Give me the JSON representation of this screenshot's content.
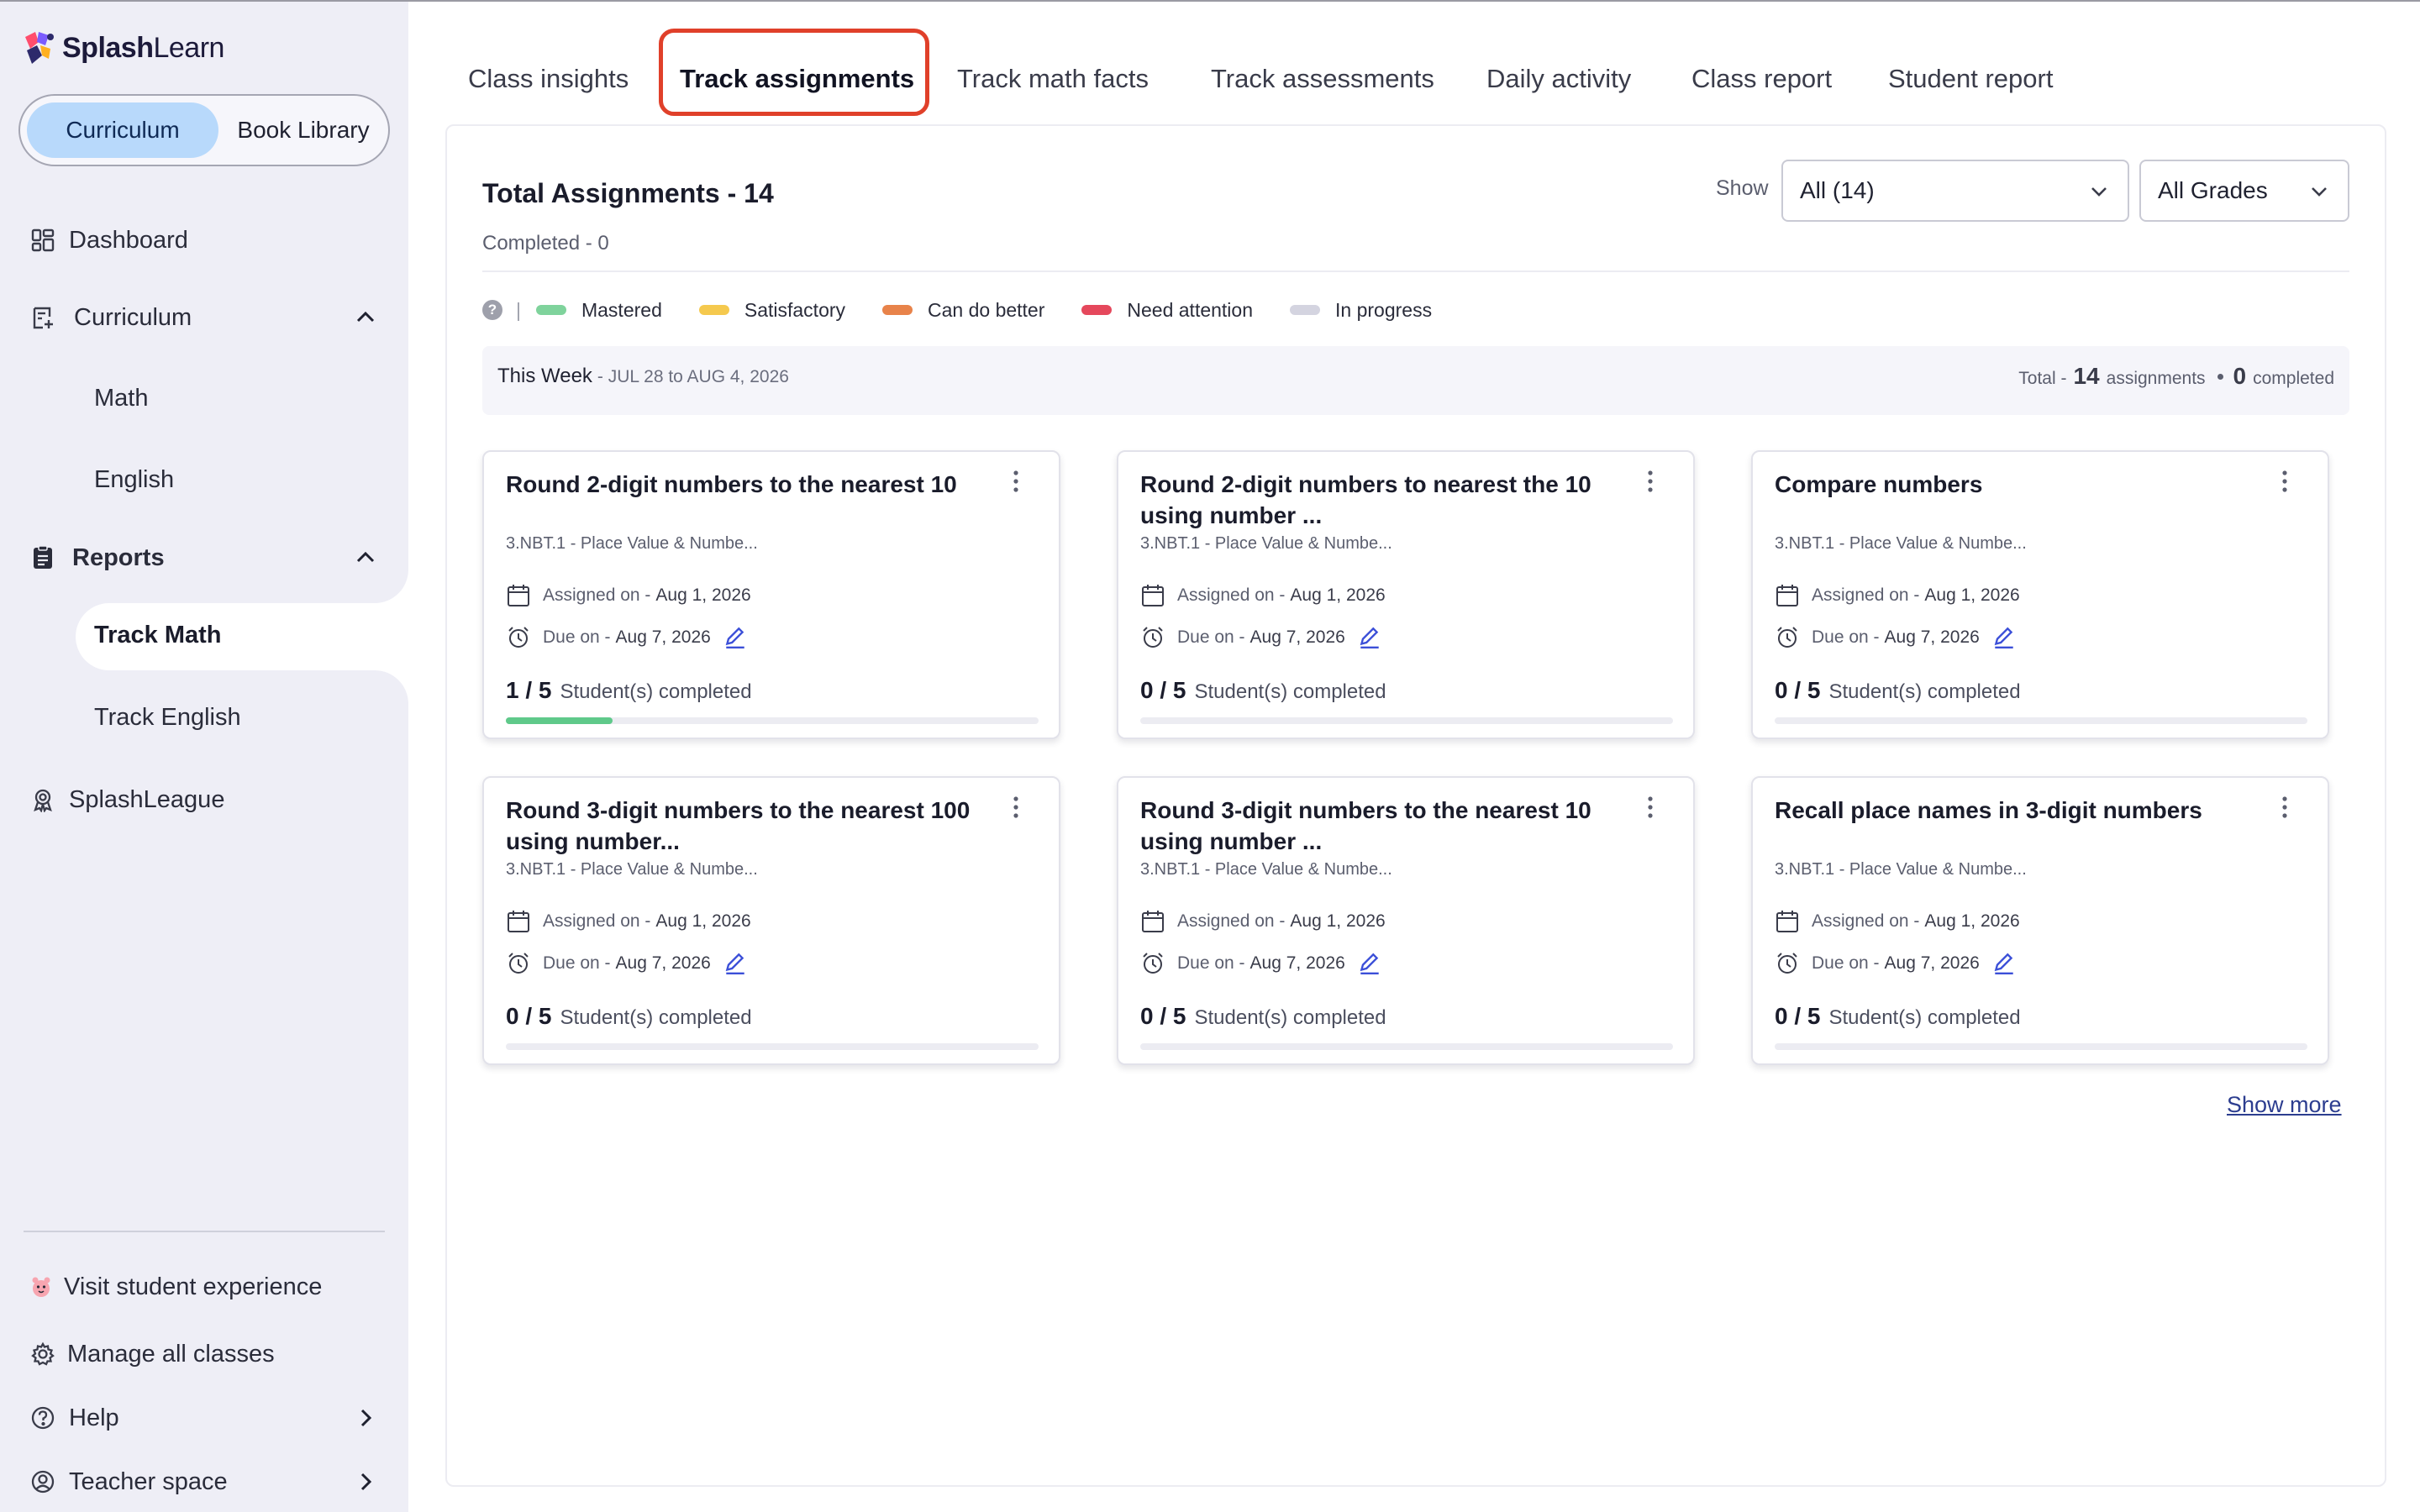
{
  "app": {
    "logo_bold": "Splash",
    "logo_light": "Learn"
  },
  "sidebar": {
    "toggle": {
      "active": "Curriculum",
      "inactive": "Book Library"
    },
    "nav": {
      "dashboard": "Dashboard",
      "curriculum": "Curriculum",
      "math": "Math",
      "english": "English",
      "reports": "Reports",
      "track_math": "Track Math",
      "track_english": "Track English",
      "splashleague": "SplashLeague"
    },
    "footer": {
      "visit_student": "Visit student experience",
      "manage_classes": "Manage all classes",
      "help": "Help",
      "teacher_space": "Teacher space"
    }
  },
  "tabs": [
    {
      "label": "Class insights",
      "active": false
    },
    {
      "label": "Track assignments",
      "active": true
    },
    {
      "label": "Track math facts",
      "active": false
    },
    {
      "label": "Track assessments",
      "active": false
    },
    {
      "label": "Daily activity",
      "active": false
    },
    {
      "label": "Class report",
      "active": false
    },
    {
      "label": "Student report",
      "active": false
    }
  ],
  "header": {
    "total": "Total Assignments - 14",
    "completed": "Completed - 0",
    "show_label": "Show",
    "filter_status": "All (14)",
    "filter_grade": "All Grades"
  },
  "legend": [
    {
      "label": "Mastered",
      "color": "#7fd39c"
    },
    {
      "label": "Satisfactory",
      "color": "#f5c94e"
    },
    {
      "label": "Can do better",
      "color": "#e8834a"
    },
    {
      "label": "Need attention",
      "color": "#e5485c"
    },
    {
      "label": "In progress",
      "color": "#d4d4e0"
    }
  ],
  "week": {
    "title": "This Week",
    "range": "- JUL 28 to AUG 4, 2026",
    "total_prefix": "Total -",
    "total_count": "14",
    "total_suffix": "assignments",
    "completed_count": "0",
    "completed_suffix": "completed"
  },
  "card_labels": {
    "assigned": "Assigned on -",
    "due": "Due on -",
    "completed_suffix": "Student(s) completed"
  },
  "cards": [
    {
      "title": "Round 2-digit numbers to the nearest 10",
      "standard": "3.NBT.1 - Place Value & Numbe...",
      "assigned": "Aug 1, 2026",
      "due": "Aug 7, 2026",
      "progress": "1 / 5",
      "completed_fraction": 0.2
    },
    {
      "title": "Round 2-digit numbers to nearest the 10 using number ...",
      "standard": "3.NBT.1 - Place Value & Numbe...",
      "assigned": "Aug 1, 2026",
      "due": "Aug 7, 2026",
      "progress": "0 / 5",
      "completed_fraction": 0
    },
    {
      "title": "Compare numbers",
      "standard": "3.NBT.1 - Place Value & Numbe...",
      "assigned": "Aug 1, 2026",
      "due": "Aug 7, 2026",
      "progress": "0 / 5",
      "completed_fraction": 0
    },
    {
      "title": "Round 3-digit numbers to the nearest 100 using number...",
      "standard": "3.NBT.1 - Place Value & Numbe...",
      "assigned": "Aug 1, 2026",
      "due": "Aug 7, 2026",
      "progress": "0 / 5",
      "completed_fraction": 0
    },
    {
      "title": "Round 3-digit numbers to the nearest 10 using number ...",
      "standard": "3.NBT.1 - Place Value & Numbe...",
      "assigned": "Aug 1, 2026",
      "due": "Aug 7, 2026",
      "progress": "0 / 5",
      "completed_fraction": 0
    },
    {
      "title": "Recall place names in 3-digit numbers",
      "standard": "3.NBT.1 - Place Value & Numbe...",
      "assigned": "Aug 1, 2026",
      "due": "Aug 7, 2026",
      "progress": "0 / 5",
      "completed_fraction": 0
    }
  ],
  "show_more": "Show more",
  "colors": {
    "accent": "#b8d9fb",
    "highlight": "#e0402a",
    "progress": "#5fc98a",
    "sidebar_bg": "#eeeef6"
  }
}
